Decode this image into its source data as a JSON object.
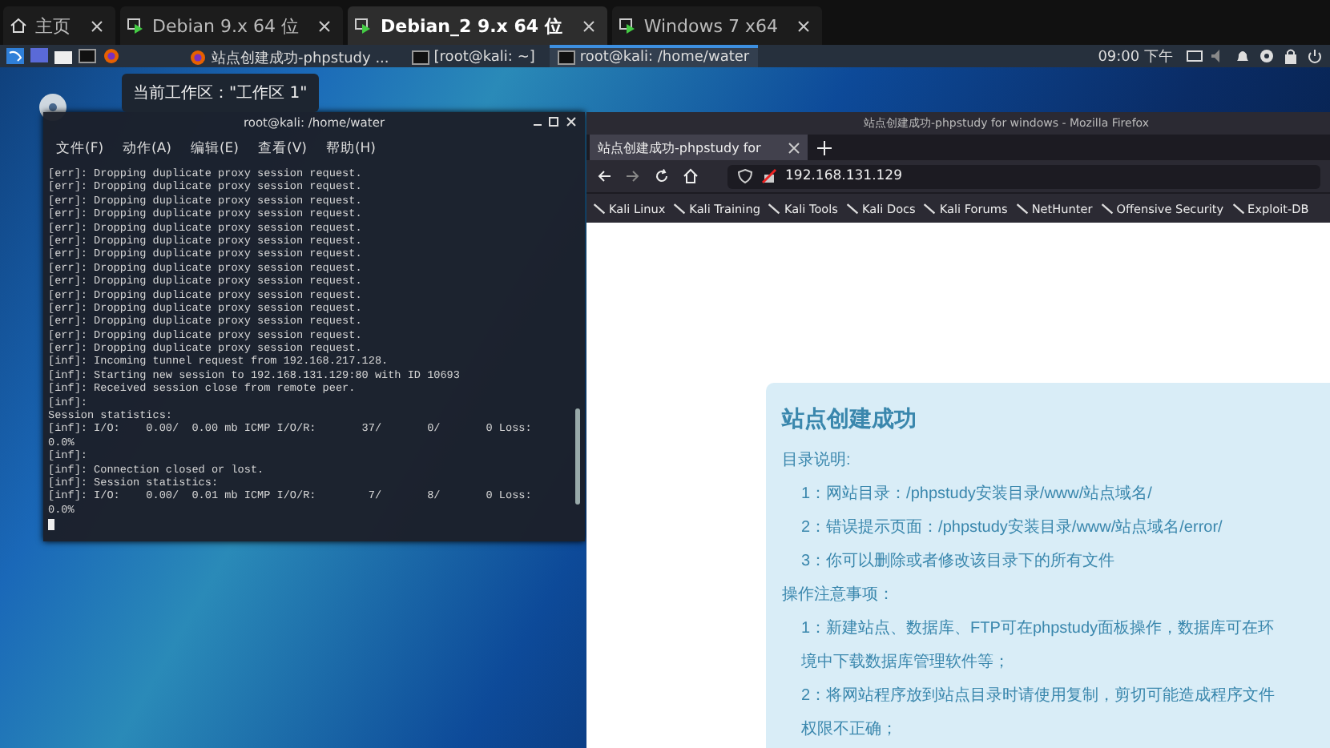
{
  "vm_tabs": [
    {
      "label": "主页",
      "kind": "home",
      "selected": false
    },
    {
      "label": "Debian 9.x 64 位",
      "kind": "vm",
      "selected": false
    },
    {
      "label": "Debian_2 9.x 64 位",
      "kind": "vm",
      "selected": true
    },
    {
      "label": "Windows 7 x64",
      "kind": "vm",
      "selected": false
    }
  ],
  "panel": {
    "windows": [
      {
        "title": "站点创建成功-phpstudy ...",
        "kind": "browser",
        "selected": false
      },
      {
        "title": "[root@kali: ~]",
        "kind": "terminal",
        "selected": false
      },
      {
        "title": "root@kali: /home/water",
        "kind": "terminal",
        "selected": true
      }
    ],
    "clock": "09:00 下午"
  },
  "workspace_tooltip": "当前工作区：\"工作区 1\"",
  "terminal": {
    "title": "root@kali: /home/water",
    "menu": [
      "文件(F)",
      "动作(A)",
      "编辑(E)",
      "查看(V)",
      "帮助(H)"
    ],
    "lines": [
      "[err]: Dropping duplicate proxy session request.",
      "[err]: Dropping duplicate proxy session request.",
      "[err]: Dropping duplicate proxy session request.",
      "[err]: Dropping duplicate proxy session request.",
      "[err]: Dropping duplicate proxy session request.",
      "[err]: Dropping duplicate proxy session request.",
      "[err]: Dropping duplicate proxy session request.",
      "[err]: Dropping duplicate proxy session request.",
      "[err]: Dropping duplicate proxy session request.",
      "[err]: Dropping duplicate proxy session request.",
      "[err]: Dropping duplicate proxy session request.",
      "[err]: Dropping duplicate proxy session request.",
      "[err]: Dropping duplicate proxy session request.",
      "[err]: Dropping duplicate proxy session request.",
      "[inf]: Incoming tunnel request from 192.168.217.128.",
      "[inf]: Starting new session to 192.168.131.129:80 with ID 10693",
      "[inf]: Received session close from remote peer.",
      "[inf]:",
      "Session statistics:",
      "[inf]: I/O:    0.00/  0.00 mb ICMP I/O/R:       37/       0/       0 Loss:",
      "0.0%",
      "[inf]:",
      "[inf]: Connection closed or lost.",
      "[inf]: Session statistics:",
      "[inf]: I/O:    0.00/  0.01 mb ICMP I/O/R:        7/       8/       0 Loss:",
      "0.0%"
    ]
  },
  "firefox": {
    "title": "站点创建成功-phpstudy for windows - Mozilla Firefox",
    "tab": {
      "label": "站点创建成功-phpstudy for",
      "selected": true
    },
    "url": "192.168.131.129",
    "bookmarks": [
      "Kali Linux",
      "Kali Training",
      "Kali Tools",
      "Kali Docs",
      "Kali Forums",
      "NetHunter",
      "Offensive Security",
      "Exploit-DB"
    ],
    "page": {
      "title": "站点创建成功",
      "lines": [
        {
          "kind": "heading",
          "text": "目录说明:"
        },
        {
          "kind": "item",
          "text": "1：网站目录：/phpstudy安装目录/www/站点域名/"
        },
        {
          "kind": "item",
          "text": "2：错误提示页面：/phpstudy安装目录/www/站点域名/error/"
        },
        {
          "kind": "item",
          "text": "3：你可以删除或者修改该目录下的所有文件"
        },
        {
          "kind": "heading",
          "text": "操作注意事项："
        },
        {
          "kind": "item",
          "text": "1：新建站点、数据库、FTP可在phpstudy面板操作，数据库可在环"
        },
        {
          "kind": "item",
          "text": "境中下载数据库管理软件等；"
        },
        {
          "kind": "item",
          "text": "2：将网站程序放到站点目录时请使用复制，剪切可能造成程序文件"
        },
        {
          "kind": "item",
          "text": "权限不正确；"
        }
      ]
    }
  }
}
